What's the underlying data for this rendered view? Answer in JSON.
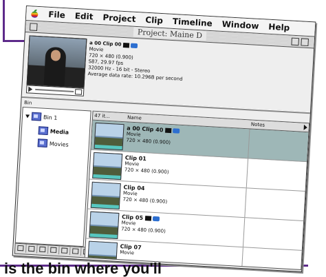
{
  "menubar": {
    "items": [
      "File",
      "Edit",
      "Project",
      "Clip",
      "Timeline",
      "Window",
      "Help"
    ]
  },
  "window": {
    "title": "Project: Maine D"
  },
  "preview_info": {
    "clip_name": "a 00 Clip 00",
    "type": "Movie",
    "dimensions": "720 × 480 (0.900)",
    "duration": "S87, 29.97 fps",
    "audio": "32000 Hz - 16 bit - Stereo",
    "data_rate": "Average data rate: 10.296B per second"
  },
  "bin": {
    "label": "Bin",
    "tree": [
      "Bin 1",
      "Media",
      "Movies"
    ]
  },
  "list": {
    "columns": [
      "47 it...",
      "Name",
      "Notes"
    ],
    "rows": [
      {
        "name": "a 00 Clip 40",
        "type": "Movie",
        "dims": "720 × 480 (0.900)",
        "selected": true
      },
      {
        "name": "Clip 01",
        "type": "Movie",
        "dims": "720 × 480 (0.900)",
        "selected": false
      },
      {
        "name": "Clip 04",
        "type": "Movie",
        "dims": "720 × 480 (0.900)",
        "selected": false
      },
      {
        "name": "Clip 05",
        "type": "Movie",
        "dims": "720 × 480 (0.900)",
        "selected": false
      },
      {
        "name": "Clip 07",
        "type": "Movie",
        "dims": "",
        "selected": false
      }
    ]
  },
  "caption": "is the bin where you'll"
}
